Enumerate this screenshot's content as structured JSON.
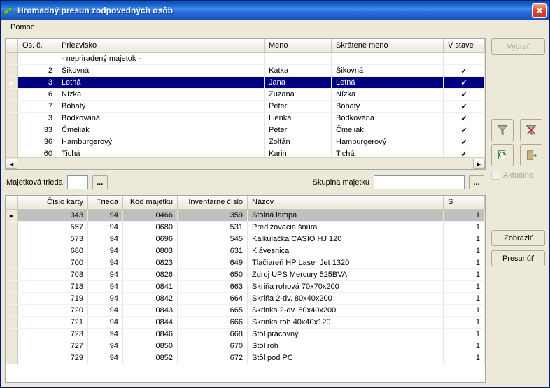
{
  "window": {
    "title": "Hromadný presun zodpovedných osôb"
  },
  "menu": {
    "help": "Pomoc"
  },
  "sidebar": {
    "select_btn": "Vybrať",
    "show_btn": "Zobraziť",
    "move_btn": "Presunúť",
    "aktualne": "Aktuálne"
  },
  "persons": {
    "headers": {
      "osc": "Os. č.",
      "priezvisko": "Priezvisko",
      "meno": "Meno",
      "skrat": "Skrátené meno",
      "vstave": "V stave"
    },
    "rows": [
      {
        "osc": "",
        "priezvisko": "- nepriradený majetok -",
        "meno": "",
        "skrat": "",
        "v": ""
      },
      {
        "osc": "2",
        "priezvisko": "Šikovná",
        "meno": "Katka",
        "skrat": "Šikovná",
        "v": "✓"
      },
      {
        "osc": "3",
        "priezvisko": "Letná",
        "meno": "Jana",
        "skrat": "Letná",
        "v": "✓",
        "sel": true
      },
      {
        "osc": "6",
        "priezvisko": "Nízka",
        "meno": "Zuzana",
        "skrat": "Nízka",
        "v": "✓"
      },
      {
        "osc": "7",
        "priezvisko": "Bohatý",
        "meno": "Peter",
        "skrat": "Bohatý",
        "v": "✓"
      },
      {
        "osc": "3",
        "priezvisko": "Bodkovaná",
        "meno": "Lienka",
        "skrat": "Bodkovaná",
        "v": "✓"
      },
      {
        "osc": "33",
        "priezvisko": "Čmeliak",
        "meno": "Peter",
        "skrat": "Čmeliak",
        "v": "✓"
      },
      {
        "osc": "36",
        "priezvisko": "Hamburgerový",
        "meno": "Zoltán",
        "skrat": "Hamburgerový",
        "v": "✓"
      },
      {
        "osc": "60",
        "priezvisko": "Tichá",
        "meno": "Karin",
        "skrat": "Tichá",
        "v": "✓"
      }
    ]
  },
  "filter": {
    "trieda_label": "Majetková trieda",
    "skupina_label": "Skupina majetku",
    "trieda_value": "",
    "skupina_value": ""
  },
  "assets": {
    "headers": {
      "karta": "Číslo karty",
      "trieda": "Trieda",
      "kod": "Kód majetku",
      "inv": "Inventárne číslo",
      "nazov": "Názov",
      "s": "S"
    },
    "rows": [
      {
        "karta": "343",
        "trieda": "94",
        "kod": "0466",
        "inv": "359",
        "nazov": "Stolná lampa",
        "s": "1",
        "sel": true
      },
      {
        "karta": "557",
        "trieda": "94",
        "kod": "0680",
        "inv": "531",
        "nazov": "Predlžovacia šnúra",
        "s": "1"
      },
      {
        "karta": "573",
        "trieda": "94",
        "kod": "0696",
        "inv": "545",
        "nazov": "Kalkulačka CASIO HJ 120",
        "s": "1"
      },
      {
        "karta": "680",
        "trieda": "94",
        "kod": "0803",
        "inv": "631",
        "nazov": "Klávesnica",
        "s": "1"
      },
      {
        "karta": "700",
        "trieda": "94",
        "kod": "0823",
        "inv": "649",
        "nazov": "Tlačiareň HP Laser Jet 1320",
        "s": "1"
      },
      {
        "karta": "703",
        "trieda": "94",
        "kod": "0826",
        "inv": "650",
        "nazov": "Zdroj UPS Mercury 525BVA",
        "s": "1"
      },
      {
        "karta": "718",
        "trieda": "94",
        "kod": "0841",
        "inv": "663",
        "nazov": "Skriňa rohová 70x70x200",
        "s": "1"
      },
      {
        "karta": "719",
        "trieda": "94",
        "kod": "0842",
        "inv": "664",
        "nazov": "Skriňa 2-dv. 80x40x200",
        "s": "1"
      },
      {
        "karta": "720",
        "trieda": "94",
        "kod": "0843",
        "inv": "665",
        "nazov": "Skrinka 2-dv. 80x40x200",
        "s": "1"
      },
      {
        "karta": "721",
        "trieda": "94",
        "kod": "0844",
        "inv": "666",
        "nazov": "Skrinka roh 40x40x120",
        "s": "1"
      },
      {
        "karta": "723",
        "trieda": "94",
        "kod": "0846",
        "inv": "668",
        "nazov": "Stôl pracovný",
        "s": "1"
      },
      {
        "karta": "727",
        "trieda": "94",
        "kod": "0850",
        "inv": "670",
        "nazov": "Stôl roh",
        "s": "1"
      },
      {
        "karta": "729",
        "trieda": "94",
        "kod": "0852",
        "inv": "672",
        "nazov": "Stôl pod PC",
        "s": "1"
      }
    ]
  }
}
